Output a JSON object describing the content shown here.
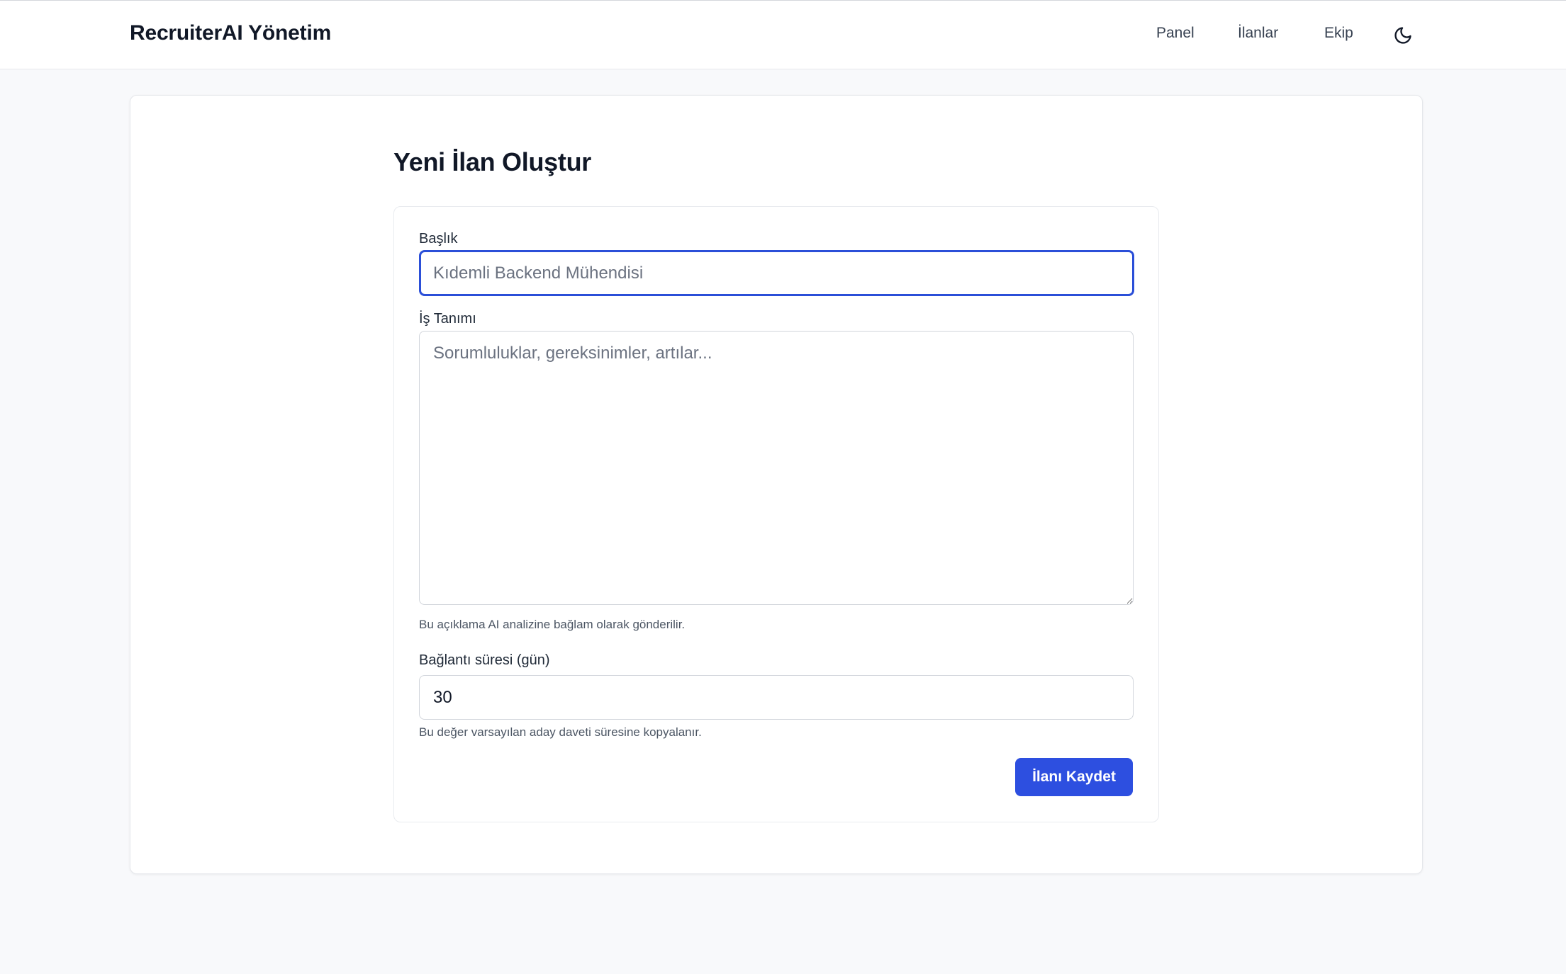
{
  "header": {
    "brand": "RecruiterAI Yönetim",
    "nav": [
      {
        "label": "Panel"
      },
      {
        "label": "İlanlar"
      },
      {
        "label": "Ekip"
      }
    ],
    "theme_toggle_icon": "moon-icon"
  },
  "main": {
    "page_title": "Yeni İlan Oluştur",
    "form": {
      "title_label": "Başlık",
      "title_placeholder": "Kıdemli Backend Mühendisi",
      "title_value": "",
      "description_label": "İş Tanımı",
      "description_placeholder": "Sorumluluklar, gereksinimler, artılar...",
      "description_value": "",
      "description_help": "Bu açıklama AI analizine bağlam olarak gönderilir.",
      "duration_label": "Bağlantı süresi (gün)",
      "duration_value": "30",
      "duration_help": "Bu değer varsayılan aday daveti süresine kopyalanır.",
      "save_label": "İlanı Kaydet"
    }
  },
  "colors": {
    "accent": "#2d4fe0",
    "focus_border": "#2b4fd8",
    "background": "#f8f9fb"
  }
}
